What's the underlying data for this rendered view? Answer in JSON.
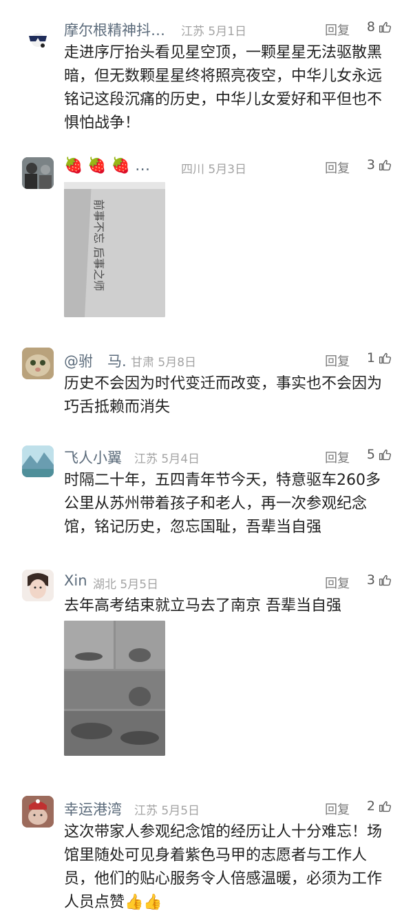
{
  "comments": [
    {
      "name": "摩尔根精神抖…",
      "location": "江苏",
      "date": "5月1日",
      "reply_label": "回复",
      "likes": "8",
      "text": "走进序厅抬头看见星空顶，一颗星星无法驱散黑暗，但无数颗星星终将照亮夜空，中华儿女永远铭记这段沉痛的历史，中华儿女爱好和平但也不惧怕战争！"
    },
    {
      "name": "🍓 🍓 🍓 …",
      "location": "四川",
      "date": "5月3日",
      "reply_label": "回复",
      "likes": "3",
      "photo_sign_text": "前事不忘 后事之师"
    },
    {
      "name": "@驸　马.",
      "location": "甘肃",
      "date": "5月8日",
      "reply_label": "回复",
      "likes": "1",
      "text": "历史不会因为时代变迁而改变，事实也不会因为巧舌抵赖而消失"
    },
    {
      "name": "飞人小翼",
      "location": "江苏",
      "date": "5月4日",
      "reply_label": "回复",
      "likes": "5",
      "text": "时隔二十年，五四青年节今天，特意驱车260多公里从苏州带着孩子和老人，再一次参观纪念馆，铭记历史，忽忘国耻，吾辈当自强"
    },
    {
      "name": "Xin",
      "location": "湖北",
      "date": "5月5日",
      "reply_label": "回复",
      "likes": "3",
      "text": "去年高考结束就立马去了南京 吾辈当自强"
    },
    {
      "name": "幸运港湾",
      "location": "江苏",
      "date": "5月5日",
      "reply_label": "回复",
      "likes": "2",
      "text": "这次带家人参观纪念馆的经历让人十分难忘！场馆里随处可见身着紫色马甲的志愿者与工作人员，他们的贴心服务令人倍感温暖，必须为工作人员点赞👍👍"
    }
  ],
  "colors": {
    "name": "#5a6a7a",
    "meta": "#a3a3a3",
    "text": "#1f1f1f"
  },
  "icons": {
    "like": "thumbs-up-icon"
  }
}
